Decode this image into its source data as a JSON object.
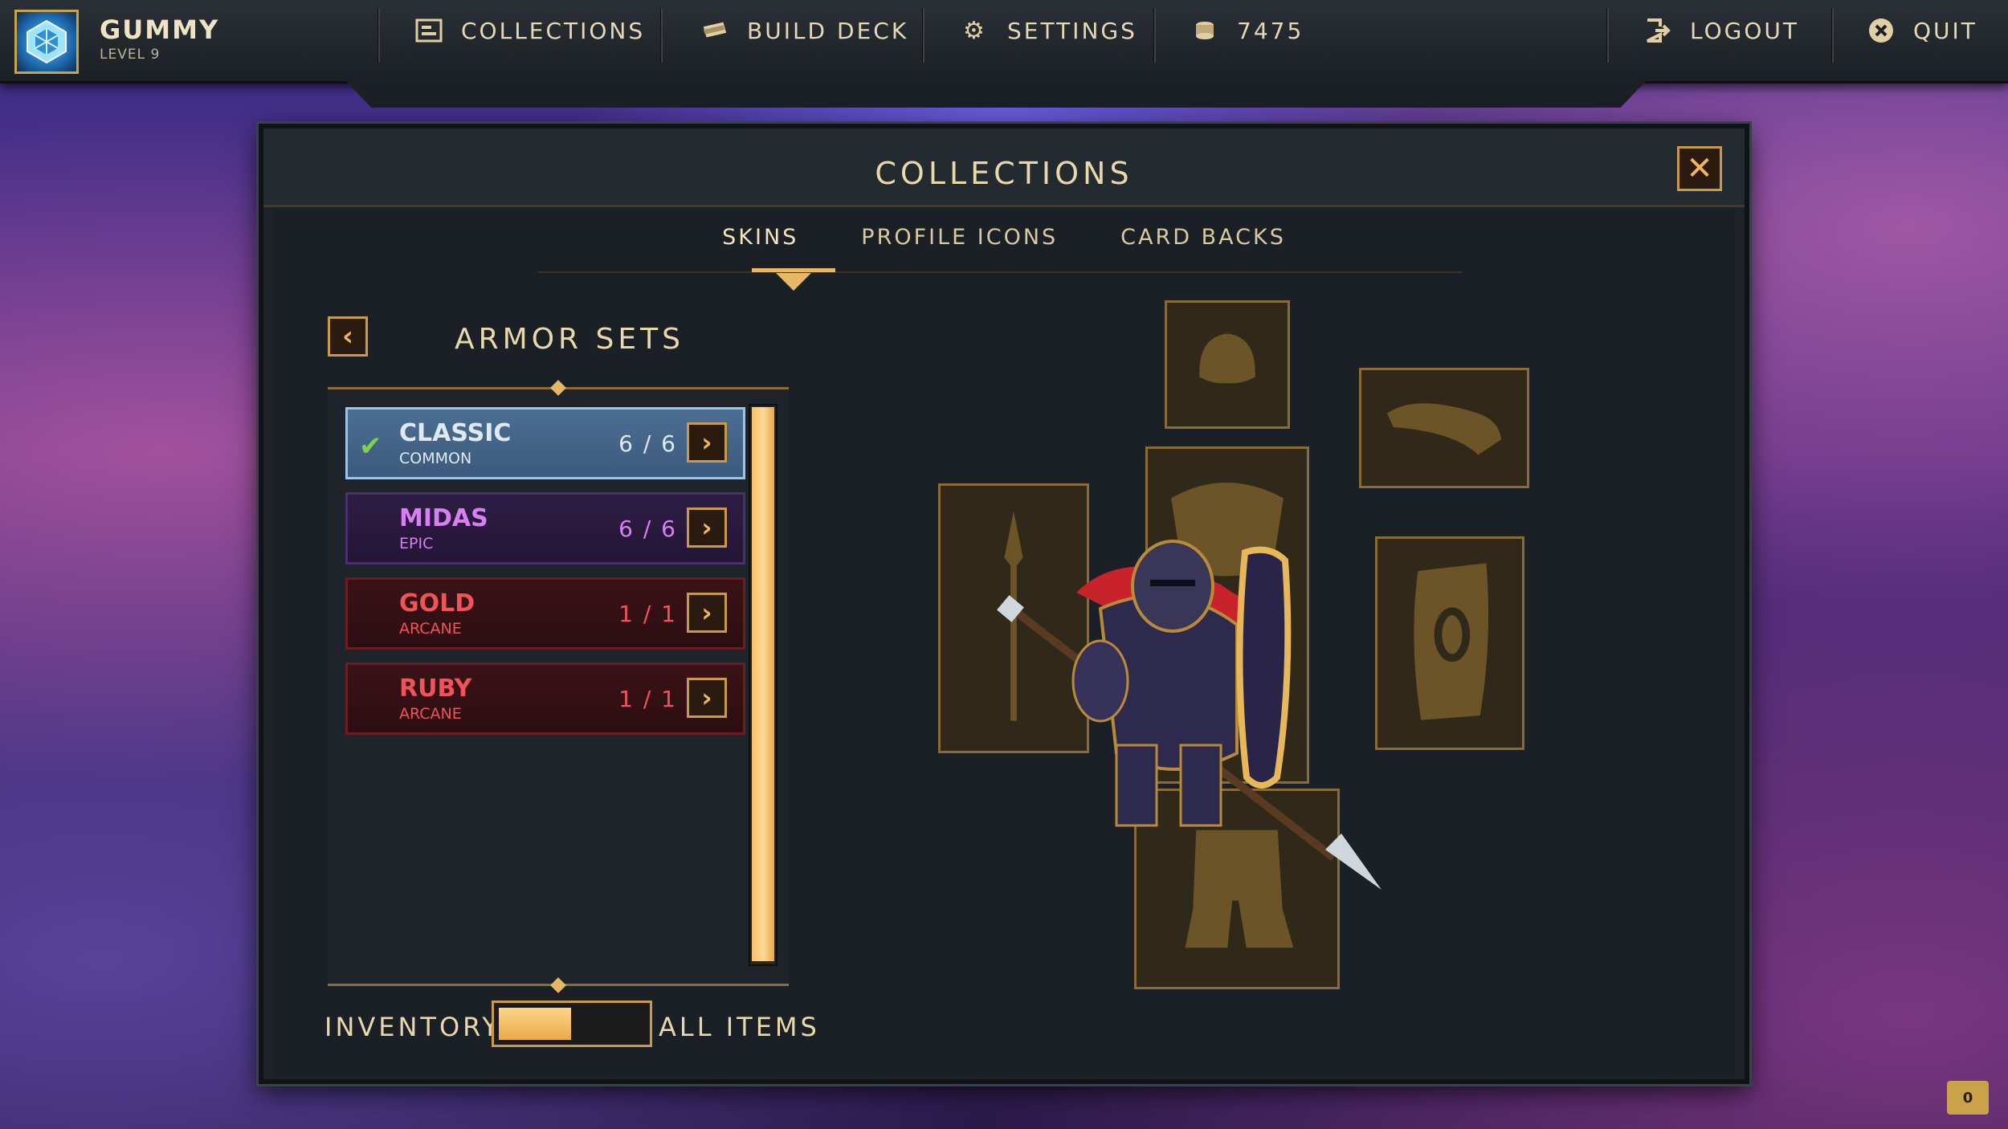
{
  "topbar": {
    "player": {
      "name": "GUMMY",
      "level": "LEVEL 9"
    },
    "nav": {
      "collections": "COLLECTIONS",
      "build_deck": "BUILD DECK",
      "settings": "SETTINGS",
      "currency": "7475",
      "logout": "LOGOUT",
      "quit": "QUIT"
    }
  },
  "panel": {
    "title": "COLLECTIONS",
    "tabs": [
      "SKINS",
      "PROFILE ICONS",
      "CARD BACKS"
    ],
    "active_tab": "SKINS",
    "list_title": "ARMOR SETS",
    "items": [
      {
        "name": "CLASSIC",
        "rarity": "COMMON",
        "count": "6 / 6",
        "selected": true
      },
      {
        "name": "MIDAS",
        "rarity": "EPIC",
        "count": "6 / 6",
        "selected": false
      },
      {
        "name": "GOLD",
        "rarity": "ARCANE",
        "count": "1 / 1",
        "selected": false
      },
      {
        "name": "RUBY",
        "rarity": "ARCANE",
        "count": "1 / 1",
        "selected": false
      }
    ],
    "toggle": {
      "left_label": "INVENTORY",
      "right_label": "ALL ITEMS",
      "state": "INVENTORY"
    },
    "equipment_slots": [
      "helmet-slot",
      "shoulder-slot",
      "chest-slot",
      "weapon-slot",
      "shield-slot",
      "legs-slot"
    ]
  },
  "chat": {
    "count": "0"
  },
  "colors": {
    "accent_gold": "#e8b765",
    "common": "#4c6e93",
    "epic": "#d87ff2",
    "arcane": "#f0535a"
  }
}
